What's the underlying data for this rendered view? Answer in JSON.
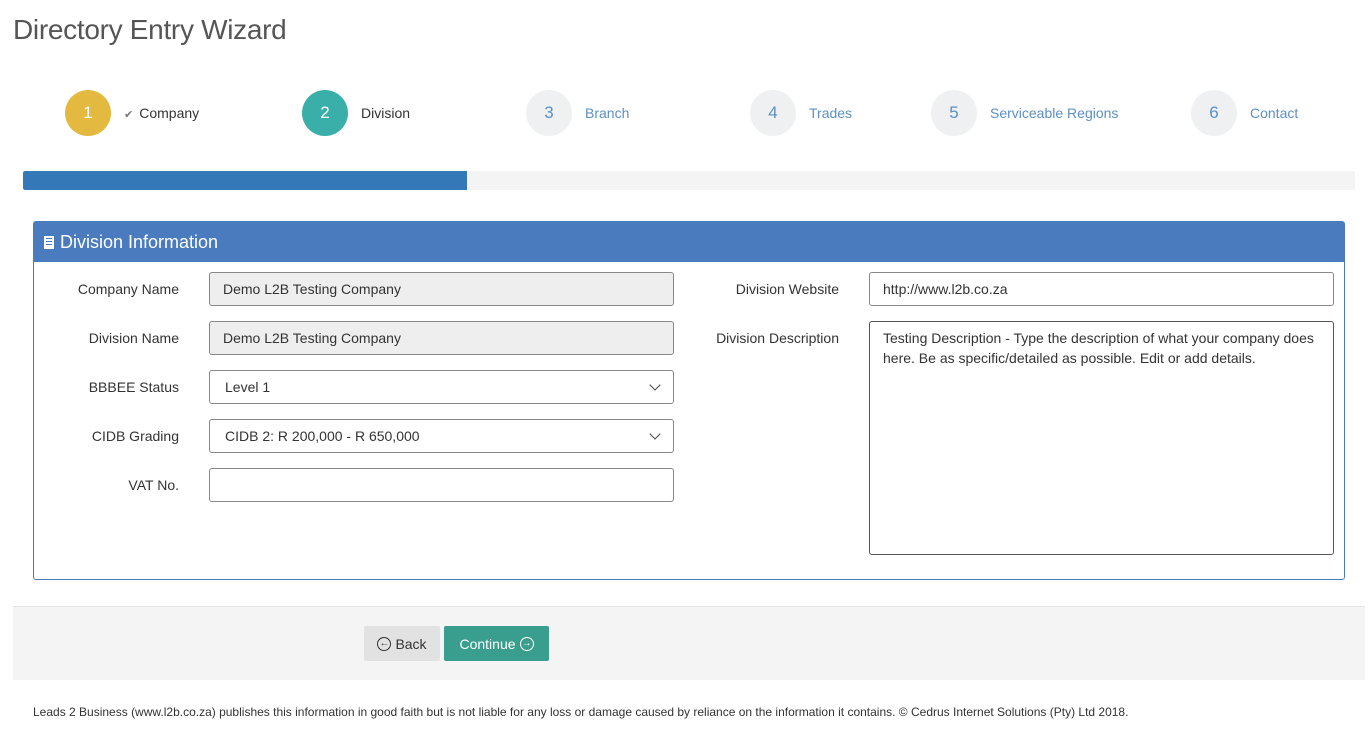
{
  "page": {
    "title": "Directory Entry Wizard"
  },
  "steps": [
    {
      "number": "1",
      "label": "Company",
      "state": "done"
    },
    {
      "number": "2",
      "label": "Division",
      "state": "active"
    },
    {
      "number": "3",
      "label": "Branch",
      "state": "todo"
    },
    {
      "number": "4",
      "label": "Trades",
      "state": "todo"
    },
    {
      "number": "5",
      "label": "Serviceable Regions",
      "state": "todo"
    },
    {
      "number": "6",
      "label": "Contact",
      "state": "todo"
    }
  ],
  "progress": {
    "fraction": 0.333
  },
  "panel": {
    "title": "Division Information",
    "icon": "building-icon"
  },
  "form": {
    "company_name": {
      "label": "Company Name",
      "value": "Demo L2B Testing Company"
    },
    "division_name": {
      "label": "Division Name",
      "value": "Demo L2B Testing Company"
    },
    "bbbee_status": {
      "label": "BBBEE Status",
      "value": "Level 1"
    },
    "cidb_grading": {
      "label": "CIDB Grading",
      "value": "CIDB 2: R 200,000 - R 650,000"
    },
    "vat_no": {
      "label": "VAT No.",
      "value": ""
    },
    "division_website": {
      "label": "Division Website",
      "value": "http://www.l2b.co.za"
    },
    "division_description": {
      "label": "Division Description",
      "value": "Testing Description - Type the description of what your company does here. Be as specific/detailed as possible. Edit or add details."
    }
  },
  "buttons": {
    "back": "Back",
    "continue": "Continue"
  },
  "footer": {
    "disclaimer": "Leads 2 Business (www.l2b.co.za) publishes this information in good faith but is not liable for any loss or damage caused by reliance on the information it contains. © Cedrus Internet Solutions (Pty) Ltd 2018."
  },
  "colors": {
    "done": "#e3b93f",
    "active": "#3aafa9",
    "primary": "#4a7bbf",
    "progress": "#3478b7",
    "continue": "#3a9e8f"
  }
}
